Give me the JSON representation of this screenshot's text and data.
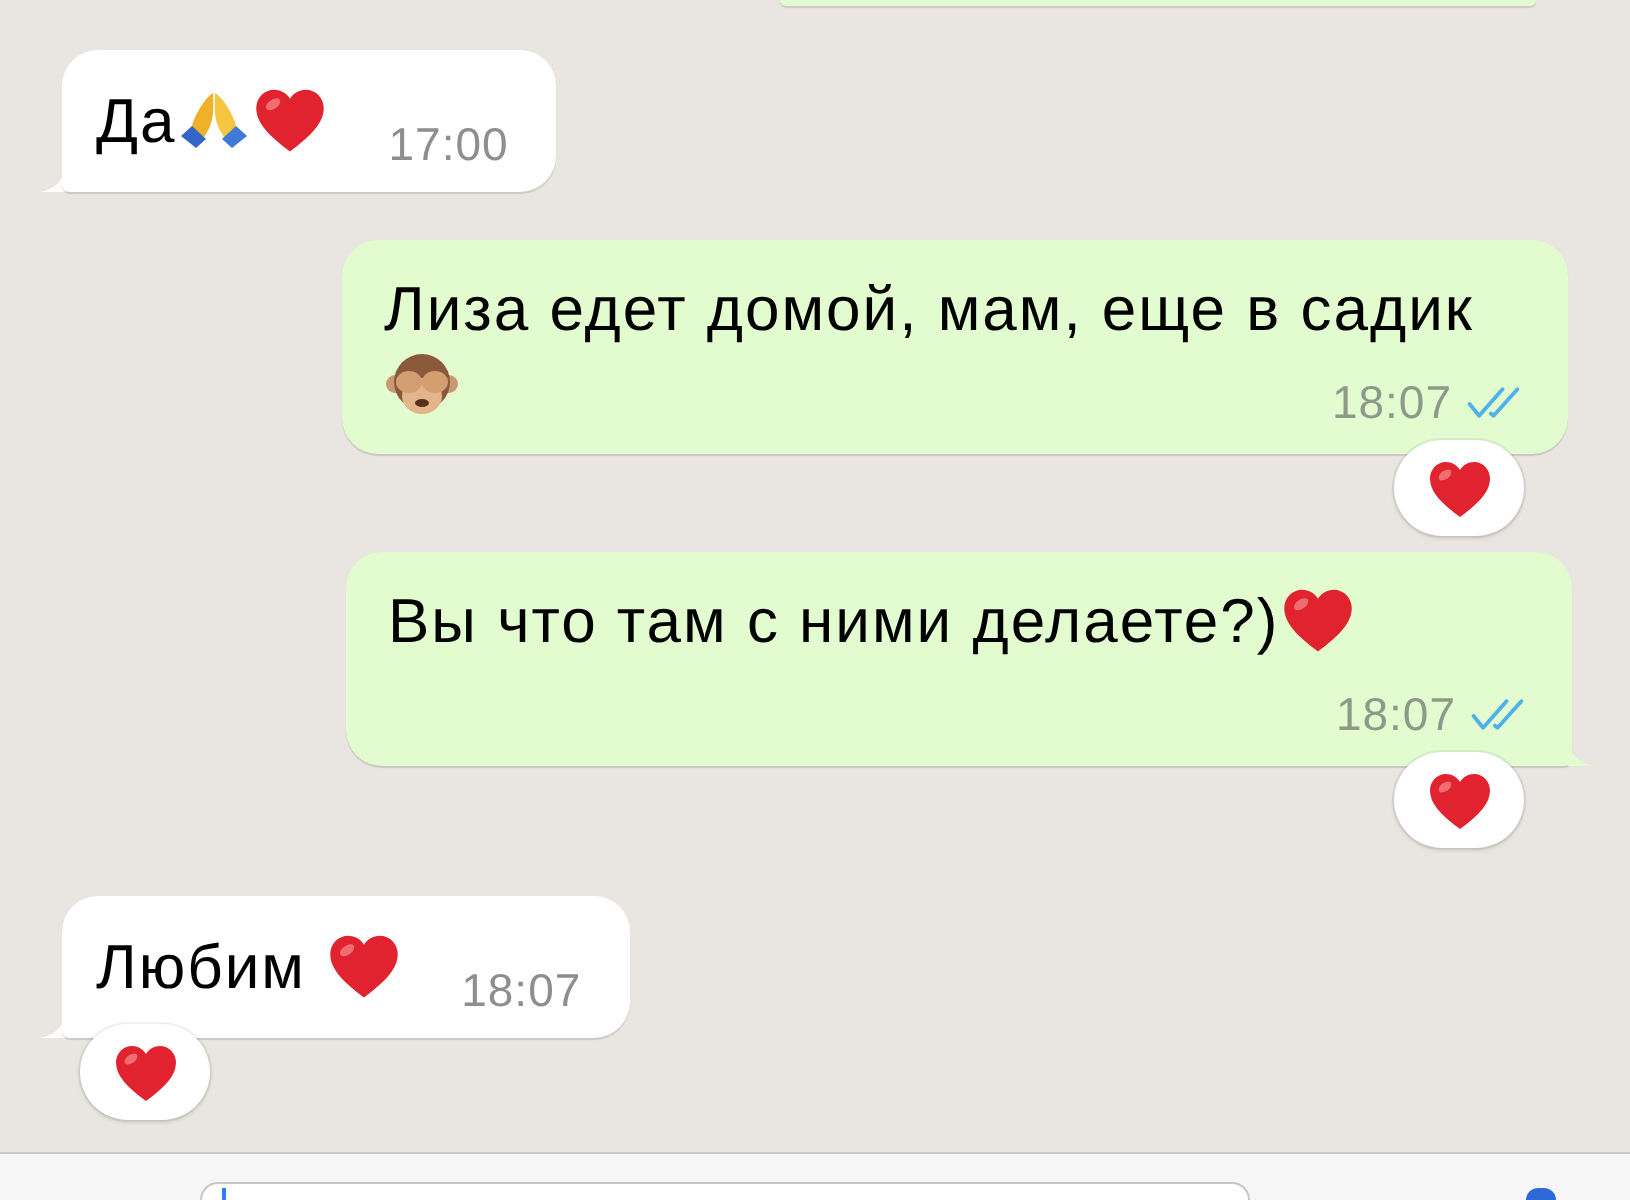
{
  "messages": [
    {
      "kind": "incoming",
      "parts": [
        {
          "kind": "text",
          "text": "Да"
        },
        {
          "kind": "pray"
        },
        {
          "kind": "heart"
        }
      ],
      "time": "17:00",
      "tail": true,
      "reacted": false
    },
    {
      "kind": "outgoing",
      "parts": [
        {
          "kind": "text",
          "text": "Лиза едет домой, мам, еще в садик"
        },
        {
          "kind": "monkey"
        }
      ],
      "time": "18:07",
      "read": true,
      "tail": false,
      "reacted": true
    },
    {
      "kind": "outgoing",
      "parts": [
        {
          "kind": "text",
          "text": "Вы что там с ними делаете?)"
        },
        {
          "kind": "heart"
        }
      ],
      "time": "18:07",
      "read": true,
      "tail": true,
      "reacted": true
    },
    {
      "kind": "incoming",
      "parts": [
        {
          "kind": "text",
          "text": "Любим "
        },
        {
          "kind": "heart"
        }
      ],
      "time": "18:07",
      "tail": true,
      "reacted": true
    }
  ],
  "composer": {
    "focused": true
  }
}
